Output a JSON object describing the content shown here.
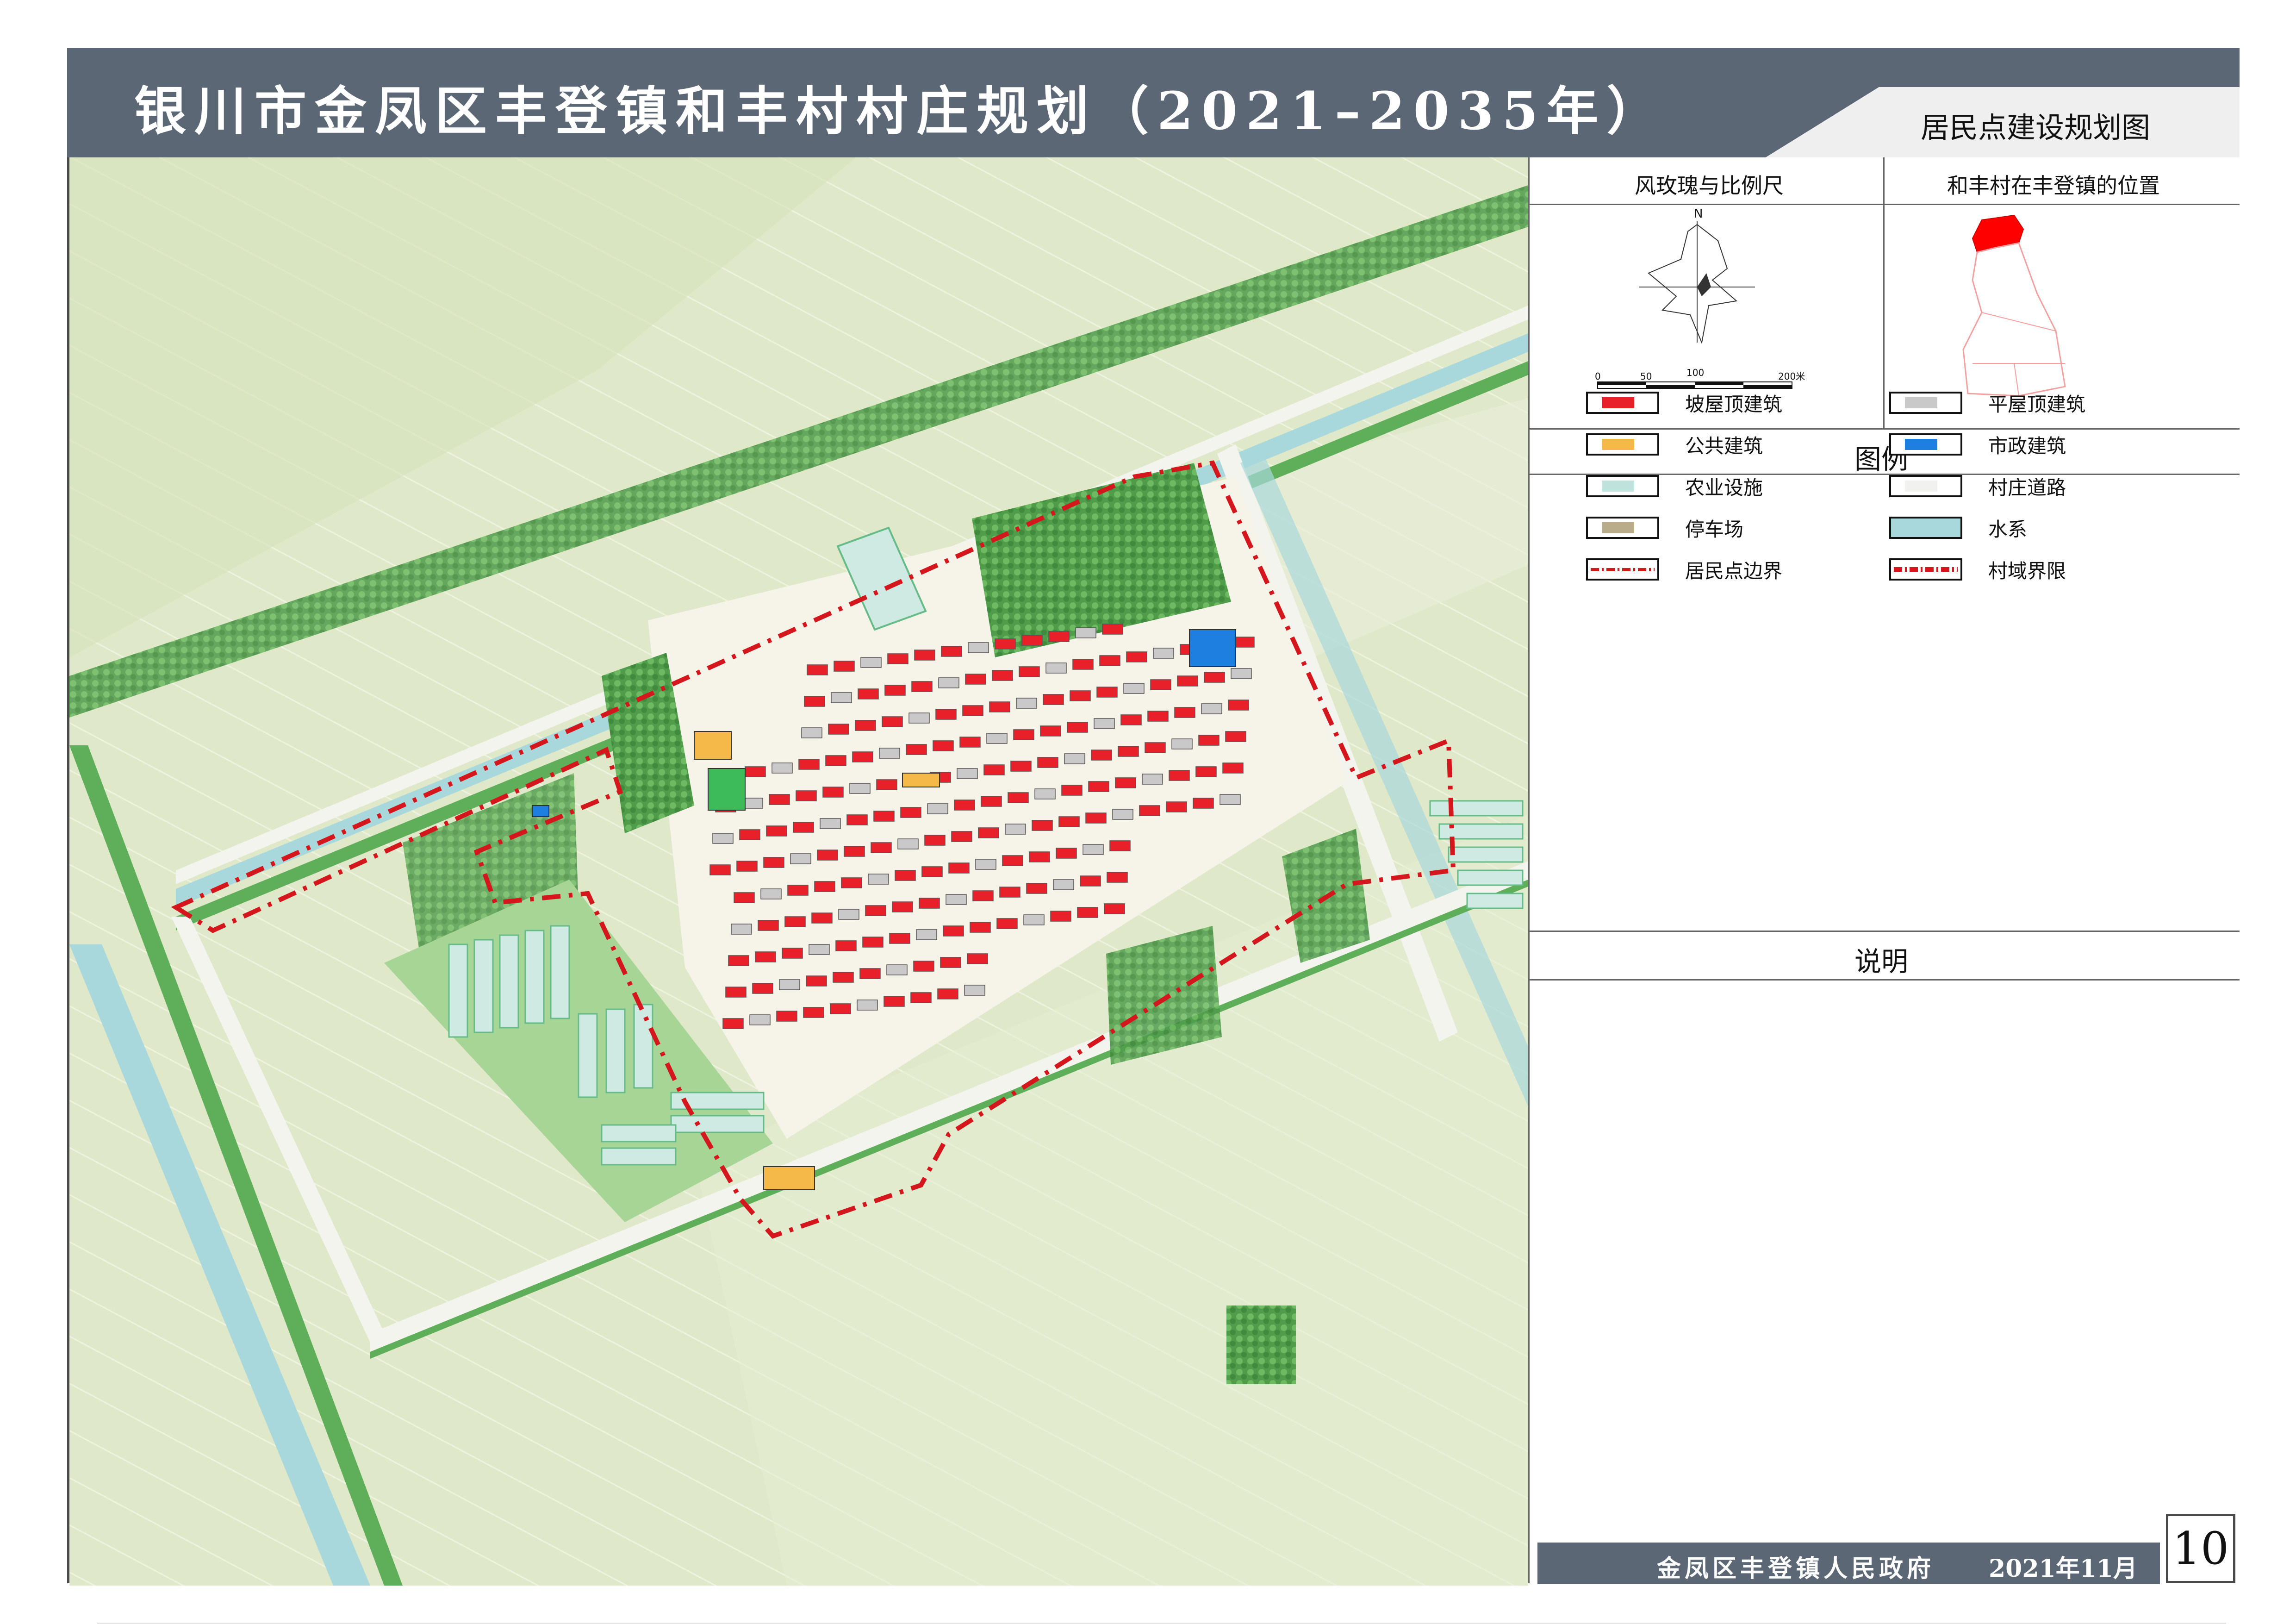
{
  "title": "银川市金凤区丰登镇和丰村村庄规划（2021–2035年）",
  "drawing_name": "居民点建设规划图",
  "panels": {
    "wind_rose_title": "风玫瑰与比例尺",
    "location_title": "和丰村在丰登镇的位置",
    "north_label": "N",
    "scale_labels": [
      "0",
      "50",
      "100",
      "200米"
    ]
  },
  "legend": {
    "title": "图例",
    "items": [
      {
        "label": "坡屋顶建筑",
        "color": "#e8202a",
        "kind": "fill"
      },
      {
        "label": "平屋顶建筑",
        "color": "#c9c9c9",
        "kind": "fill"
      },
      {
        "label": "公共建筑",
        "color": "#f5b94a",
        "kind": "fill"
      },
      {
        "label": "市政建筑",
        "color": "#1e7fe0",
        "kind": "fill"
      },
      {
        "label": "农业设施",
        "color": "#bfe3dc",
        "kind": "fill"
      },
      {
        "label": "村庄道路",
        "color": "#f1f1ef",
        "kind": "fill"
      },
      {
        "label": "停车场",
        "color": "#b9ac8a",
        "kind": "fill"
      },
      {
        "label": "水系",
        "color": "#a8d8dc",
        "kind": "water"
      },
      {
        "label": "居民点边界",
        "color": "#d4161d",
        "kind": "dashline"
      },
      {
        "label": "村域界限",
        "color": "#d4161d",
        "kind": "dashline-bold"
      }
    ]
  },
  "notes_title": "说明",
  "footer": {
    "org": "金凤区丰登镇人民政府",
    "date": "2021年11月"
  },
  "page_number": "10",
  "colors": {
    "header": "#5c6775",
    "farmland": "#dfe8c8",
    "tree_belt": "#5fae5a",
    "canal": "#9fd6d8",
    "road": "#f1f1ef",
    "boundary": "#d4161d"
  }
}
